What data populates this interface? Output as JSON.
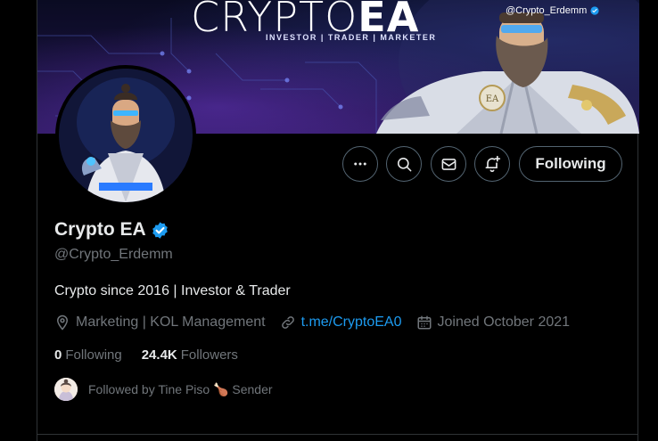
{
  "banner": {
    "title_light": "CRYPTO",
    "title_bold": "EA",
    "subtitle": "INVESTOR | TRADER | MARKETER",
    "handle": "@Crypto_Erdemm",
    "emblem": "EA"
  },
  "actions": {
    "more_icon": "more-icon",
    "search_icon": "search-icon",
    "message_icon": "mail-icon",
    "notify_icon": "bell-plus-icon",
    "following_label": "Following"
  },
  "profile": {
    "display_name": "Crypto EA",
    "handle": "@Crypto_Erdemm",
    "bio": "Crypto since 2016 | Investor & Trader",
    "location": "Marketing | KOL Management",
    "website": "t.me/CryptoEA0",
    "joined": "Joined October 2021",
    "verified_color": "#1d9bf0"
  },
  "stats": {
    "following_count": "0",
    "following_label": "Following",
    "followers_count": "24.4K",
    "followers_label": "Followers"
  },
  "followed_by": {
    "text": "Followed by Tine Piso 🍗 Sender"
  }
}
